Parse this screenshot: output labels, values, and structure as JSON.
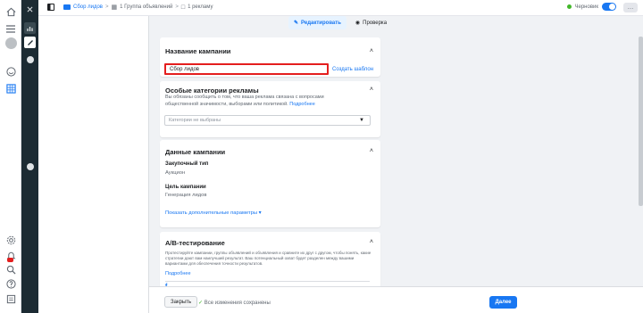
{
  "breadcrumbs": [
    {
      "label": "Сбор лидов"
    },
    {
      "label": "1 Группа объявлений"
    },
    {
      "label": "1 рекламу"
    }
  ],
  "status": {
    "label": "Черновик"
  },
  "modes": [
    {
      "label": "Редактировать"
    },
    {
      "label": "Проверка"
    }
  ],
  "campaign_name": {
    "title": "Название кампании",
    "value": "Сбор лидов",
    "create_template": "Создать шаблон"
  },
  "special_categories": {
    "title": "Особые категории рекламы",
    "description": "Вы обязаны сообщить о том, что ваша реклама связана с вопросами общественной значимости, выборами или политикой.",
    "more_link": "Подробнее",
    "select_placeholder": "Категории не выбраны"
  },
  "campaign_data": {
    "title": "Данные кампании",
    "buying_type_label": "Закупочный тип",
    "buying_type_value": "Аукцион",
    "objective_label": "Цель кампании",
    "objective_value": "Генерация лидов",
    "show_more": "Показать дополнительные параметры"
  },
  "ab_testing": {
    "title": "A/B-тестирование",
    "description": "Протестируйте кампании, группы объявлений и объявления и сравните их друг с другом, чтобы понять, какие стратегии дают вам наилучший результат. Ваш потенциальный охват будет разделен между вашими вариантами для обеспечения точности результатов.",
    "more_link": "Подробнее"
  },
  "footer": {
    "close": "Закрыть",
    "saved": "Все изменения сохранены",
    "next": "Далее"
  }
}
